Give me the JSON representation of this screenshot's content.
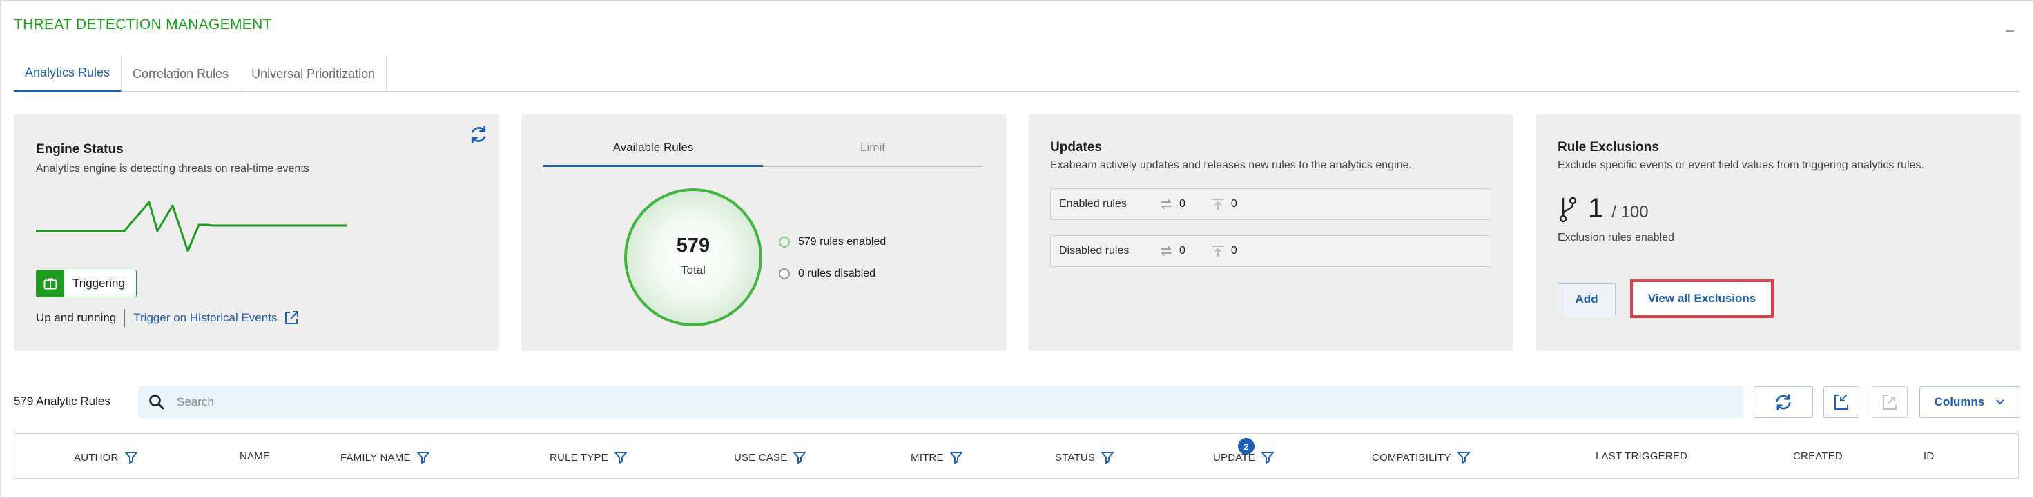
{
  "page": {
    "title": "THREAT DETECTION MANAGEMENT"
  },
  "tabs": [
    {
      "label": "Analytics Rules",
      "active": true
    },
    {
      "label": "Correlation Rules",
      "active": false
    },
    {
      "label": "Universal Prioritization",
      "active": false
    }
  ],
  "engine": {
    "title": "Engine Status",
    "subtitle": "Analytics engine is detecting threats on real-time events",
    "badge": "Triggering",
    "status": "Up and running",
    "link": "Trigger on Historical Events"
  },
  "available": {
    "tabs": [
      "Available Rules",
      "Limit"
    ],
    "total": "579",
    "total_label": "Total",
    "enabled": "579 rules enabled",
    "disabled": "0 rules disabled"
  },
  "updates": {
    "title": "Updates",
    "subtitle": "Exabeam actively updates and releases new rules to the analytics engine.",
    "enabled_label": "Enabled rules",
    "enabled_changed": "0",
    "enabled_new": "0",
    "disabled_label": "Disabled rules",
    "disabled_changed": "0",
    "disabled_new": "0"
  },
  "exclusions": {
    "title": "Rule Exclusions",
    "subtitle": "Exclude specific events or event field values from triggering analytics rules.",
    "count": "1",
    "max": "/ 100",
    "caption": "Exclusion rules enabled",
    "add_label": "Add",
    "view_label": "View all Exclusions"
  },
  "table": {
    "count_label": "579 Analytic Rules",
    "search_placeholder": "Search",
    "columns_label": "Columns",
    "update_filter_count": "2",
    "headers": {
      "author": "AUTHOR",
      "name": "NAME",
      "family": "FAMILY NAME",
      "rule_type": "RULE TYPE",
      "use_case": "USE CASE",
      "mitre": "MITRE",
      "status": "STATUS",
      "update": "UPDATE",
      "compat": "COMPATIBILITY",
      "last": "LAST TRIGGERED",
      "created": "CREATED",
      "id": "ID"
    }
  },
  "colors": {
    "brand_green": "#1aa01a",
    "link_blue": "#1d5fb8",
    "highlight_red": "#e8404a"
  }
}
